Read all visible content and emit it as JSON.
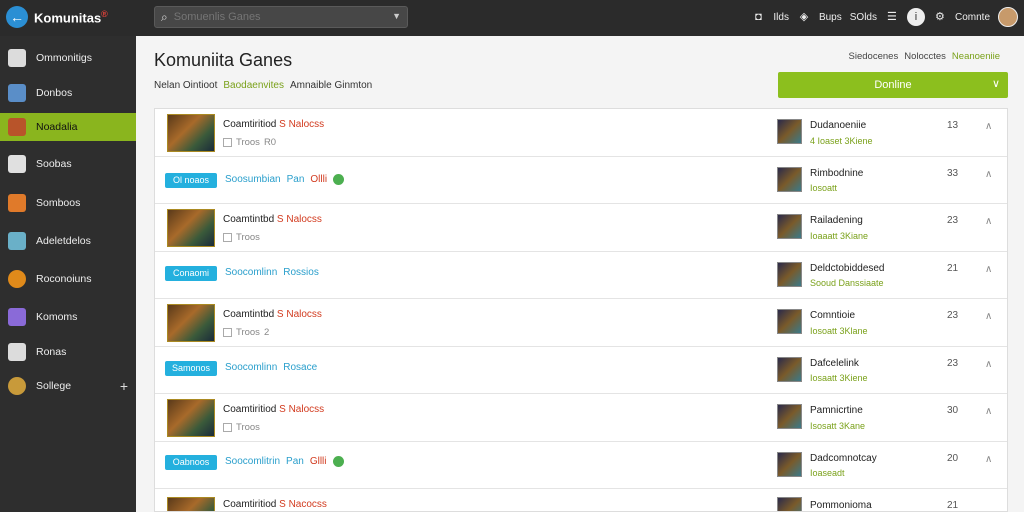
{
  "app": {
    "name": "Komunitas",
    "mark": "®"
  },
  "search": {
    "placeholder": "Somuenlis Ganes"
  },
  "topbar": {
    "item1": "Ilds",
    "item2": "Bups",
    "item3": "SOlds",
    "user": "Comnte"
  },
  "sidebar": {
    "items": [
      {
        "label": "Ommonitigs",
        "icon": "home-icon",
        "color": "#dcdcdc"
      },
      {
        "label": "Donbos",
        "icon": "grid-icon",
        "color": "#5a8ec8"
      },
      {
        "label": "Noadalia",
        "icon": "game-icon",
        "color": "#b8542a"
      },
      {
        "label": "Soobas",
        "icon": "tag-icon",
        "color": "#e0e0e0"
      },
      {
        "label": "Somboos",
        "icon": "puzzle-icon",
        "color": "#e07a2a"
      },
      {
        "label": "Adeletdelos",
        "icon": "tools-icon",
        "color": "#6ab0c8"
      },
      {
        "label": "Roconoiuns",
        "icon": "orange-icon",
        "color": "#e08a1a"
      },
      {
        "label": "Komoms",
        "icon": "grid2-icon",
        "color": "#8a6ad8"
      },
      {
        "label": "Ronas",
        "icon": "box-icon",
        "color": "#dcdcdc"
      },
      {
        "label": "Sollege",
        "icon": "globe-icon",
        "color": "#c89a3a"
      }
    ]
  },
  "header": {
    "title": "Komuniita Ganes",
    "sub1": "Nelan Ointioot",
    "sub2": "Baodaenvites",
    "sub3": "Amnaible Ginmton",
    "filter1": "Siedocenes",
    "filter2": "Nolocctes",
    "filter3": "Neanoeniie",
    "dropdown": "Donline"
  },
  "rows": [
    {
      "type": "game",
      "title": "Coamtiritiod",
      "tag": "S Nalocss",
      "meta": "Troos",
      "meta2": "R0",
      "avatar_name": "Dudanoeniie",
      "avatar_sub": "4 Ioaset 3Kiene",
      "count": "13"
    },
    {
      "type": "promo",
      "badge": "Ol noaos",
      "text": "Soosumbian",
      "text2": "Pan",
      "pill": "Ollli",
      "avatar_name": "Rimbodnine",
      "avatar_sub": "Iosoatt",
      "count": "33"
    },
    {
      "type": "game",
      "title": "Coamtintbd",
      "tag": "S Nalocss",
      "meta": "Troos",
      "meta2": "",
      "avatar_name": "Railadening",
      "avatar_sub": "Ioaaatt 3Kiane",
      "count": "23"
    },
    {
      "type": "promo",
      "badge": "Conaomi",
      "text": "Soocomlinn",
      "text2": "Rossios",
      "pill": "",
      "avatar_name": "Deldctobiddesed",
      "avatar_sub": "Sooud Danssiaate",
      "count": "21"
    },
    {
      "type": "game",
      "title": "Coamtintbd",
      "tag": "S Nalocss",
      "meta": "Troos",
      "meta2": "2",
      "avatar_name": "Comntioie",
      "avatar_sub": "Iosoatt 3Klane",
      "count": "23"
    },
    {
      "type": "promo",
      "badge": "Samonos",
      "text": "Soocomlinn",
      "text2": "Rosace",
      "pill": "",
      "avatar_name": "Dafcelelink",
      "avatar_sub": "Iosaatt 3Kiene",
      "count": "23"
    },
    {
      "type": "game",
      "title": "Coamtiritiod",
      "tag": "S Nalocss",
      "meta": "Troos",
      "meta2": "",
      "avatar_name": "Pamnicrtine",
      "avatar_sub": "Isosatt 3Kane",
      "count": "30"
    },
    {
      "type": "promo",
      "badge": "Oabnoos",
      "text": "Soocomlitrin",
      "text2": "Pan",
      "pill": "Gllli",
      "avatar_name": "Dadcomnotcay",
      "avatar_sub": "Ioaseadt",
      "count": "20"
    },
    {
      "type": "game",
      "title": "Coamtiritiod",
      "tag": "S Nacocss",
      "meta": "",
      "meta2": "",
      "avatar_name": "Pommonioma",
      "avatar_sub": "",
      "count": "21"
    }
  ]
}
